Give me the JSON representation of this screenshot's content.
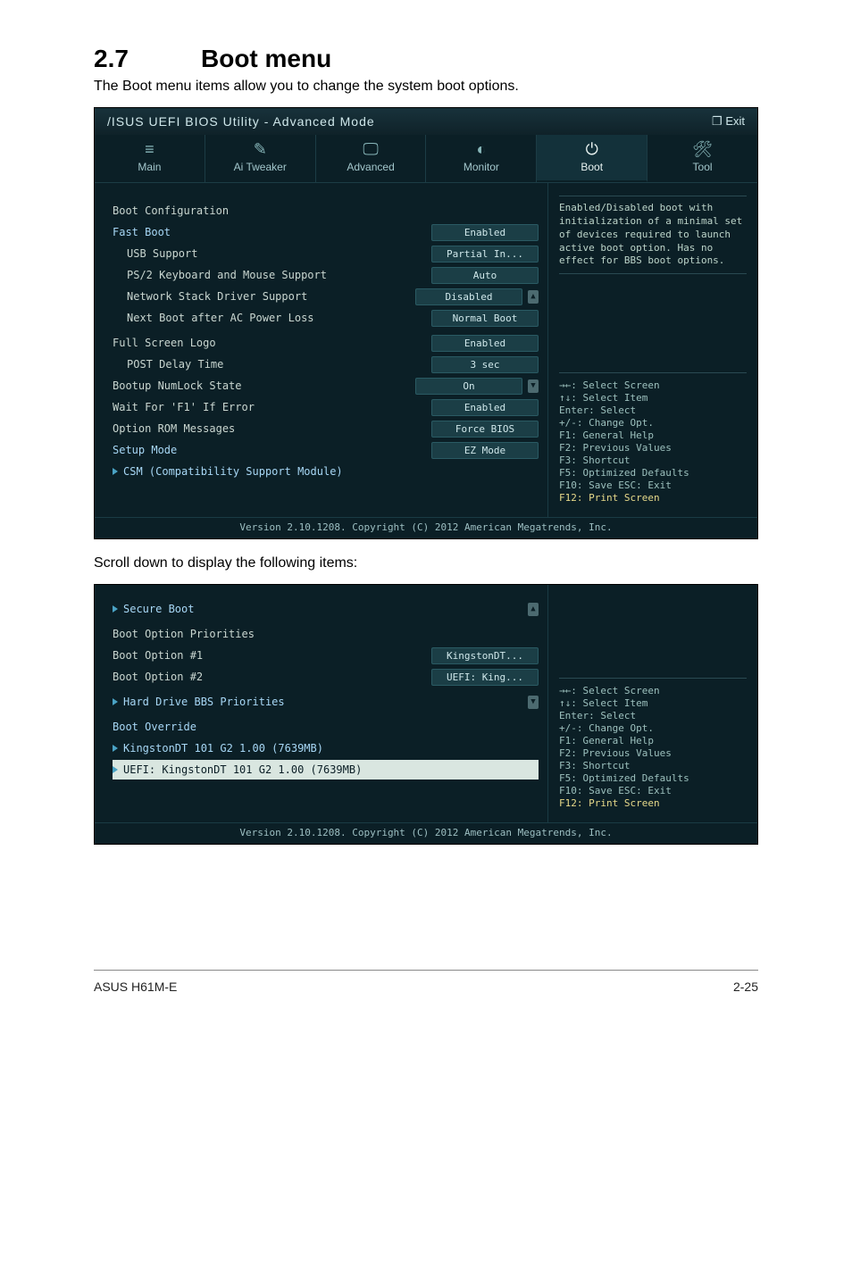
{
  "doc": {
    "section_number": "2.7",
    "section_title": "Boot menu",
    "intro": "The Boot menu items allow you to change the system boot options.",
    "scroll_note": "Scroll down to display the following items:",
    "footer_left": "ASUS H61M-E",
    "footer_right": "2-25"
  },
  "bios1": {
    "titlebar": {
      "logo": "/ISUS UEFI BIOS Utility - Advanced Mode",
      "exit": "Exit"
    },
    "tabs": {
      "main": "Main",
      "ai": "Ai Tweaker",
      "adv": "Advanced",
      "mon": "Monitor",
      "boot": "Boot",
      "tool": "Tool"
    },
    "rows": {
      "boot_cfg": "Boot Configuration",
      "fast_boot": {
        "label": "Fast Boot",
        "val": "Enabled"
      },
      "usb_support": {
        "label": "USB Support",
        "val": "Partial In..."
      },
      "ps2": {
        "label": "PS/2 Keyboard and Mouse Support",
        "val": "Auto"
      },
      "net_stack": {
        "label": "Network Stack Driver Support",
        "val": "Disabled"
      },
      "next_boot": {
        "label": "Next Boot after AC Power Loss",
        "val": "Normal Boot"
      },
      "full_logo": {
        "label": "Full Screen Logo",
        "val": "Enabled"
      },
      "post_delay": {
        "label": "POST Delay Time",
        "val": "3 sec"
      },
      "numlock": {
        "label": "Bootup NumLock State",
        "val": "On"
      },
      "wait_f1": {
        "label": "Wait For 'F1' If Error",
        "val": "Enabled"
      },
      "oprom": {
        "label": "Option ROM Messages",
        "val": "Force BIOS"
      },
      "setup_mode": {
        "label": "Setup Mode",
        "val": "EZ Mode"
      },
      "csm": "CSM (Compatibility Support Module)"
    },
    "help": "Enabled/Disabled boot with initialization of a minimal set of devices required to launch active boot option. Has no effect for BBS boot options.",
    "keys": {
      "k1": "→←: Select Screen",
      "k2": "↑↓: Select Item",
      "k3": "Enter: Select",
      "k4": "+/-: Change Opt.",
      "k5": "F1: General Help",
      "k6": "F2: Previous Values",
      "k7": "F3: Shortcut",
      "k8": "F5: Optimized Defaults",
      "k9": "F10: Save   ESC: Exit",
      "k10": "F12: Print Screen"
    },
    "footer": "Version 2.10.1208. Copyright (C) 2012 American Megatrends, Inc."
  },
  "bios2": {
    "rows": {
      "secure_boot": "Secure Boot",
      "bop_header": "Boot Option Priorities",
      "bo1": {
        "label": "Boot Option #1",
        "val": "KingstonDT..."
      },
      "bo2": {
        "label": "Boot Option #2",
        "val": "UEFI: King..."
      },
      "hdd_bbs": "Hard Drive BBS Priorities",
      "override": "Boot Override",
      "ov1": "KingstonDT 101 G2 1.00  (7639MB)",
      "ov2": "UEFI: KingstonDT 101 G2 1.00 (7639MB)"
    },
    "keys": {
      "k1": "→←: Select Screen",
      "k2": "↑↓: Select Item",
      "k3": "Enter: Select",
      "k4": "+/-: Change Opt.",
      "k5": "F1: General Help",
      "k6": "F2: Previous Values",
      "k7": "F3: Shortcut",
      "k8": "F5: Optimized Defaults",
      "k9": "F10: Save   ESC: Exit",
      "k10": "F12: Print Screen"
    },
    "footer": "Version 2.10.1208. Copyright (C) 2012 American Megatrends, Inc."
  }
}
